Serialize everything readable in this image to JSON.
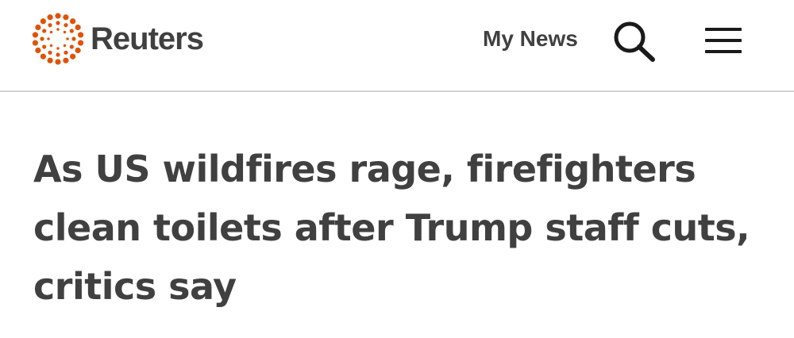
{
  "header": {
    "logo": {
      "name": "Reuters",
      "brand_color": "#e05206",
      "icon": "reuters-dotted-circle-logo"
    },
    "my_news_label": "My News",
    "search_icon": "search-icon",
    "menu_icon": "hamburger-menu-icon"
  },
  "article": {
    "headline": "As US wildfires rage, firefighters clean toilets after Trump staff cuts, critics say"
  },
  "colors": {
    "text": "#404040",
    "divider": "#d4d4d4",
    "background": "#ffffff",
    "brand": "#e05206"
  }
}
